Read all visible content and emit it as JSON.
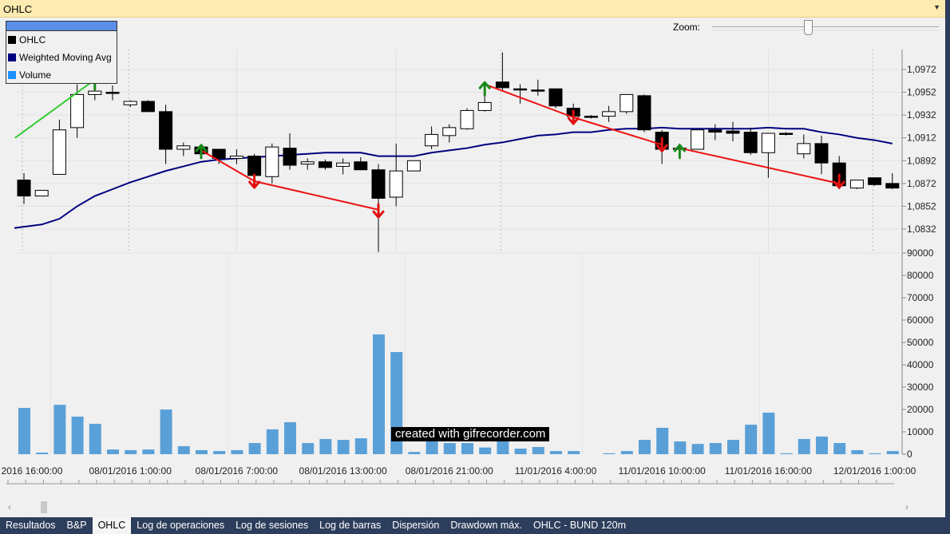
{
  "window": {
    "title": "OHLC"
  },
  "legend": {
    "items": [
      {
        "label": "OHLC",
        "color": "#000000"
      },
      {
        "label": "Weighted Moving Avg",
        "color": "#000080"
      },
      {
        "label": "Volume",
        "color": "#1e90ff"
      }
    ]
  },
  "zoom": {
    "label": "Zoom:",
    "level": 0.41
  },
  "watermark": "created with gifrecorder.com",
  "tabs": [
    {
      "label": "Resultados"
    },
    {
      "label": "B&P"
    },
    {
      "label": "OHLC",
      "selected": true
    },
    {
      "label": "Log de operaciones"
    },
    {
      "label": "Log de sesiones"
    },
    {
      "label": "Log de barras"
    },
    {
      "label": "Dispersión"
    },
    {
      "label": "Drawdown máx."
    },
    {
      "label": "OHLC - BUND 120m"
    }
  ],
  "chart_data": [
    {
      "type": "candlestick",
      "ylim": [
        1.0812,
        1.0987
      ],
      "yticks": [
        "1,0832",
        "1,0852",
        "1,0872",
        "1,0892",
        "1,0912",
        "1,0932",
        "1,0952",
        "1,0972"
      ],
      "xtick_labels": [
        {
          "index": 0,
          "label": "2016 16:00:00"
        },
        {
          "index": 6,
          "label": "08/01/2016 1:00:00"
        },
        {
          "index": 12,
          "label": "08/01/2016 7:00:00"
        },
        {
          "index": 18,
          "label": "08/01/2016 13:00:00"
        },
        {
          "index": 24,
          "label": "08/01/2016 21:00:00"
        },
        {
          "index": 30,
          "label": "11/01/2016 4:00:00"
        },
        {
          "index": 36,
          "label": "11/01/2016 10:00:00"
        },
        {
          "index": 42,
          "label": "11/01/2016 16:00:00"
        },
        {
          "index": 48,
          "label": "12/01/2016 1:00:00"
        }
      ],
      "ohlc": [
        [
          1.0875,
          1.0881,
          1.0854,
          1.0861
        ],
        [
          1.0861,
          1.0866,
          1.0861,
          1.0866
        ],
        [
          1.088,
          1.0928,
          1.088,
          1.0919
        ],
        [
          1.0921,
          1.0959,
          1.0912,
          1.095
        ],
        [
          1.095,
          1.0963,
          1.0945,
          1.0953
        ],
        [
          1.0952,
          1.0958,
          1.0945,
          1.0951
        ],
        [
          1.0941,
          1.0945,
          1.0939,
          1.0944
        ],
        [
          1.0944,
          1.0945,
          1.0935,
          1.0935
        ],
        [
          1.0935,
          1.0941,
          1.0889,
          1.0902
        ],
        [
          1.0902,
          1.0908,
          1.0896,
          1.0905
        ],
        [
          1.0904,
          1.0905,
          1.0894,
          1.0898
        ],
        [
          1.0902,
          1.0902,
          1.0889,
          1.0894
        ],
        [
          1.0894,
          1.0902,
          1.0889,
          1.0896
        ],
        [
          1.0896,
          1.0898,
          1.0875,
          1.0879
        ],
        [
          1.0878,
          1.0907,
          1.0872,
          1.0904
        ],
        [
          1.0903,
          1.0916,
          1.0884,
          1.0888
        ],
        [
          1.0889,
          1.0894,
          1.0884,
          1.0891
        ],
        [
          1.0891,
          1.0893,
          1.0884,
          1.0886
        ],
        [
          1.0887,
          1.0894,
          1.088,
          1.089
        ],
        [
          1.0891,
          1.0895,
          1.0884,
          1.0884
        ],
        [
          1.0884,
          1.0889,
          1.0812,
          1.0859
        ],
        [
          1.086,
          1.0907,
          1.0852,
          1.0883
        ],
        [
          1.0883,
          1.0892,
          1.0883,
          1.0892
        ],
        [
          1.0905,
          1.0922,
          1.0902,
          1.0915
        ],
        [
          1.0914,
          1.0924,
          1.0908,
          1.0921
        ],
        [
          1.092,
          1.0938,
          1.0919,
          1.0936
        ],
        [
          1.0936,
          1.0951,
          1.0935,
          1.0943
        ],
        [
          1.0961,
          1.0987,
          1.0954,
          1.0956
        ],
        [
          1.0955,
          1.0959,
          1.0942,
          1.0954
        ],
        [
          1.0954,
          1.0963,
          1.0949,
          1.0953
        ],
        [
          1.0955,
          1.0955,
          1.0938,
          1.094
        ],
        [
          1.0938,
          1.0942,
          1.0924,
          1.0931
        ],
        [
          1.0931,
          1.0932,
          1.0929,
          1.093
        ],
        [
          1.0931,
          1.094,
          1.0926,
          1.0935
        ],
        [
          1.0935,
          1.095,
          1.0933,
          1.095
        ],
        [
          1.0949,
          1.095,
          1.0917,
          1.0919
        ],
        [
          1.0917,
          1.0919,
          1.0889,
          1.0902
        ],
        [
          1.0902,
          1.0907,
          1.0896,
          1.0903
        ],
        [
          1.0902,
          1.0919,
          1.0902,
          1.0919
        ],
        [
          1.0919,
          1.0924,
          1.091,
          1.0917
        ],
        [
          1.0918,
          1.0926,
          1.0909,
          1.0916
        ],
        [
          1.0917,
          1.0921,
          1.0897,
          1.0899
        ],
        [
          1.0899,
          1.0916,
          1.0877,
          1.0916
        ],
        [
          1.0916,
          1.0917,
          1.0914,
          1.0915
        ],
        [
          1.0898,
          1.0915,
          1.0894,
          1.0907
        ],
        [
          1.0907,
          1.0914,
          1.088,
          1.089
        ],
        [
          1.089,
          1.0896,
          1.0867,
          1.087
        ],
        [
          1.0868,
          1.0875,
          1.0867,
          1.0875
        ],
        [
          1.0877,
          1.0877,
          1.087,
          1.0871
        ],
        [
          1.0872,
          1.0881,
          1.0867,
          1.0868
        ]
      ],
      "wma": [
        1.0833,
        1.0836,
        1.0841,
        1.0852,
        1.0861,
        1.0867,
        1.0873,
        1.0878,
        1.0883,
        1.0887,
        1.0891,
        1.0893,
        1.0894,
        1.0895,
        1.0896,
        1.0897,
        1.0898,
        1.0899,
        1.0899,
        1.0899,
        1.0896,
        1.0896,
        1.0896,
        1.0899,
        1.0901,
        1.0903,
        1.0906,
        1.0908,
        1.0911,
        1.0914,
        1.0915,
        1.0917,
        1.0917,
        1.0919,
        1.092,
        1.092,
        1.0921,
        1.092,
        1.092,
        1.092,
        1.092,
        1.092,
        1.0921,
        1.092,
        1.092,
        1.0917,
        1.0915,
        1.0912,
        1.091,
        1.0907
      ],
      "signals": [
        {
          "index": 4,
          "dir": "buy",
          "price": 1.096
        },
        {
          "index": 10,
          "dir": "buy",
          "price": 1.09
        },
        {
          "index": 13,
          "dir": "sell",
          "price": 1.0874
        },
        {
          "index": 20,
          "dir": "sell",
          "price": 1.0848
        },
        {
          "index": 26,
          "dir": "buy",
          "price": 1.0955
        },
        {
          "index": 31,
          "dir": "sell",
          "price": 1.093
        },
        {
          "index": 36,
          "dir": "sell",
          "price": 1.0906
        },
        {
          "index": 37,
          "dir": "buy",
          "price": 1.09
        },
        {
          "index": 46,
          "dir": "sell",
          "price": 1.0874
        }
      ],
      "trades": [
        {
          "from": [
            -0.5,
            1.0912
          ],
          "to": [
            4,
            1.0963
          ],
          "color": "#33cc33"
        },
        {
          "from": [
            10,
            1.0901
          ],
          "to": [
            13,
            1.0874
          ],
          "color": "#ee1111"
        },
        {
          "from": [
            13,
            1.0874
          ],
          "to": [
            20,
            1.0849
          ],
          "color": "#ee1111"
        },
        {
          "from": [
            26,
            1.0959
          ],
          "to": [
            31,
            1.093
          ],
          "color": "#ee1111"
        },
        {
          "from": [
            31,
            1.093
          ],
          "to": [
            36,
            1.0906
          ],
          "color": "#ee1111"
        },
        {
          "from": [
            37,
            1.0903
          ],
          "to": [
            46,
            1.0872
          ],
          "color": "#ee1111"
        }
      ]
    },
    {
      "type": "bar",
      "ylim": [
        0,
        90000
      ],
      "yticks": [
        "0",
        "10000",
        "20000",
        "30000",
        "40000",
        "50000",
        "60000",
        "70000",
        "80000",
        "90000"
      ],
      "color": "#5aa0d8",
      "values": [
        20700,
        700,
        22100,
        16800,
        13600,
        2100,
        1800,
        2100,
        20000,
        3600,
        1800,
        1400,
        1800,
        5000,
        11100,
        14300,
        5000,
        6800,
        6400,
        7100,
        53600,
        45700,
        1000,
        6000,
        5000,
        5000,
        3000,
        7000,
        2500,
        3200,
        1400,
        1400,
        0,
        400,
        1400,
        6400,
        11800,
        5700,
        4600,
        5000,
        6400,
        13200,
        18600,
        400,
        6800,
        7900,
        5000,
        1800,
        400,
        1400
      ]
    }
  ]
}
